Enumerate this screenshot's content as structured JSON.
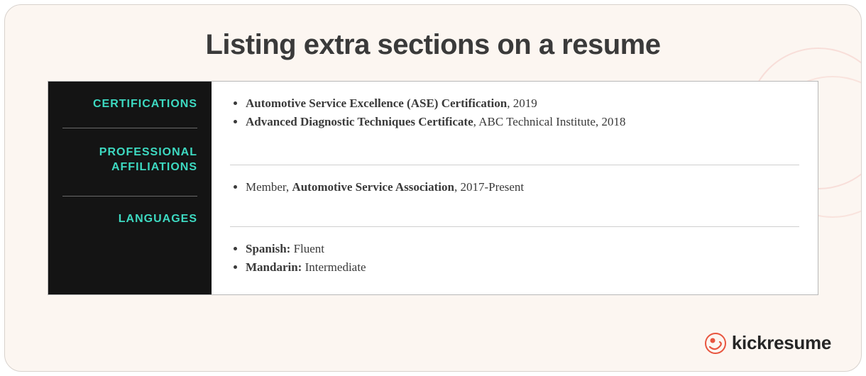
{
  "title": "Listing extra sections on a resume",
  "sections": [
    {
      "label": "CERTIFICATIONS",
      "items": [
        {
          "bold": "Automotive Service Excellence (ASE) Certification",
          "after": ", 2019"
        },
        {
          "bold": "Advanced Diagnostic Techniques Certificate",
          "after": ", ABC Technical Institute, 2018"
        }
      ]
    },
    {
      "label": "PROFESSIONAL AFFILIATIONS",
      "items": [
        {
          "before": "Member, ",
          "bold": "Automotive Service Association",
          "after": ", 2017-Present"
        }
      ]
    },
    {
      "label": "LANGUAGES",
      "items": [
        {
          "boldPrefix": "Spanish:",
          "rest": " Fluent"
        },
        {
          "boldPrefix": "Mandarin:",
          "rest": " Intermediate"
        }
      ]
    }
  ],
  "brand": "kickresume",
  "colors": {
    "accent": "#3DD9C1",
    "brandRed": "#E8553F"
  }
}
